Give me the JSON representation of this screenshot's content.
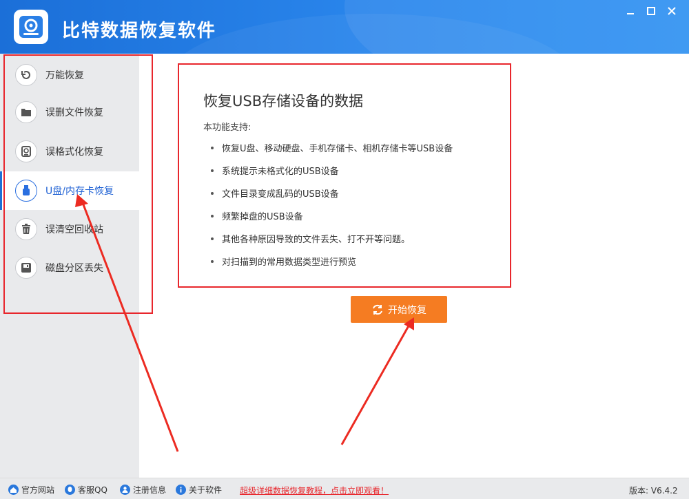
{
  "app": {
    "title": "比特数据恢复软件",
    "window_controls": [
      "minimize",
      "maximize",
      "close"
    ]
  },
  "sidebar": {
    "items": [
      {
        "label": "万能恢复",
        "icon": "undo-icon",
        "active": false
      },
      {
        "label": "误删文件恢复",
        "icon": "folder-icon",
        "active": false
      },
      {
        "label": "误格式化恢复",
        "icon": "format-disk-icon",
        "active": false
      },
      {
        "label": "U盘/内存卡恢复",
        "icon": "usb-drive-icon",
        "active": true
      },
      {
        "label": "误清空回收站",
        "icon": "trash-icon",
        "active": false
      },
      {
        "label": "磁盘分区丢失",
        "icon": "disk-icon",
        "active": false
      }
    ]
  },
  "main": {
    "title": "恢复USB存储设备的数据",
    "subtitle": "本功能支持:",
    "features": [
      "恢复U盘、移动硬盘、手机存储卡、相机存储卡等USB设备",
      "系统提示未格式化的USB设备",
      "文件目录变成乱码的USB设备",
      "频繁掉盘的USB设备",
      "其他各种原因导致的文件丢失、打不开等问题。",
      "对扫描到的常用数据类型进行预览"
    ],
    "start_button": "开始恢复"
  },
  "footer": {
    "links": [
      {
        "label": "官方网站",
        "icon": "home-icon"
      },
      {
        "label": "客服QQ",
        "icon": "qq-icon"
      },
      {
        "label": "注册信息",
        "icon": "user-icon"
      },
      {
        "label": "关于软件",
        "icon": "info-icon"
      }
    ],
    "promo": "超级详细数据恢复教程，点击立即观看！",
    "version": "版本: V6.4.2"
  },
  "colors": {
    "titlebar": "#2a86ec",
    "accent": "#1f6fd5",
    "start_button": "#f57c22",
    "highlight": "#e8262c"
  }
}
